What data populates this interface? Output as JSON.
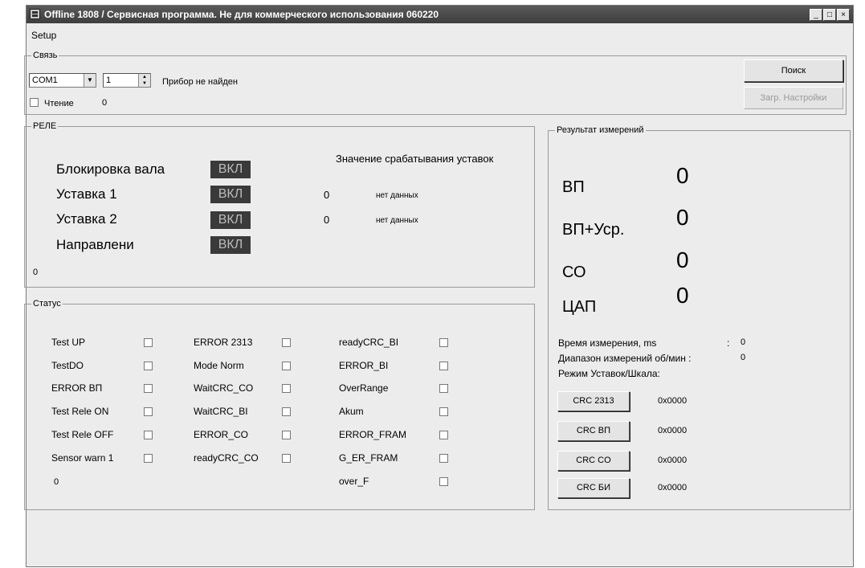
{
  "window": {
    "title": "Offline 1808   / Сервисная программа. Не для коммерческого использования 060220",
    "minimize": "_",
    "maximize": "□",
    "close": "×"
  },
  "menu": {
    "setup": "Setup"
  },
  "connection": {
    "legend": "Связь",
    "port": "COM1",
    "address": "1",
    "status": "Прибор не найден",
    "read_label": "Чтение",
    "read_count": "0",
    "search_button": "Поиск",
    "load_settings_button": "Загр. Настройки"
  },
  "relay": {
    "legend": "РЕЛЕ",
    "setpoint_header": "Значение срабатывания уставок",
    "items": [
      {
        "label": "Блокировка вала",
        "state": "ВКЛ",
        "value": "",
        "note": ""
      },
      {
        "label": "Уставка 1",
        "state": "ВКЛ",
        "value": "0",
        "note": "нет данных"
      },
      {
        "label": "Уставка 2",
        "state": "ВКЛ",
        "value": "0",
        "note": "нет данных"
      },
      {
        "label": "Направлени",
        "state": "ВКЛ",
        "value": "",
        "note": ""
      }
    ],
    "footer_value": "0"
  },
  "status": {
    "legend": "Статус",
    "col1": [
      "Test UP",
      "TestDO",
      "ERROR ВП",
      "Test Rele ON",
      "Test Rele OFF",
      "Sensor warn 1"
    ],
    "col2": [
      "ERROR 2313",
      "Mode Norm",
      "WaitCRC_CO",
      "WaitCRC_BI",
      "ERROR_CO",
      "readyCRC_CO"
    ],
    "col3": [
      "readyCRC_BI",
      "ERROR_BI",
      "OverRange",
      "Akum",
      "ERROR_FRAM",
      "G_ER_FRAM",
      "over_F"
    ],
    "footer_value": "0"
  },
  "results": {
    "legend": "Результат измерений",
    "measurements": [
      {
        "label": "ВП",
        "value": "0"
      },
      {
        "label": "ВП+Уср.",
        "value": "0"
      },
      {
        "label": "СО",
        "value": "0"
      },
      {
        "label": "ЦАП",
        "value": "0"
      }
    ],
    "time_label": "Время измерения, ms",
    "time_sep": ":",
    "time_value": "0",
    "range_label": "Диапазон измерений об/мин :",
    "range_value": "0",
    "mode_label": "Режим Уставок/Шкала:",
    "crc": [
      {
        "button": "CRC 2313",
        "value": "0x0000"
      },
      {
        "button": "CRC ВП",
        "value": "0x0000"
      },
      {
        "button": "CRC CO",
        "value": "0x0000"
      },
      {
        "button": "CRC БИ",
        "value": "0x0000"
      }
    ]
  }
}
